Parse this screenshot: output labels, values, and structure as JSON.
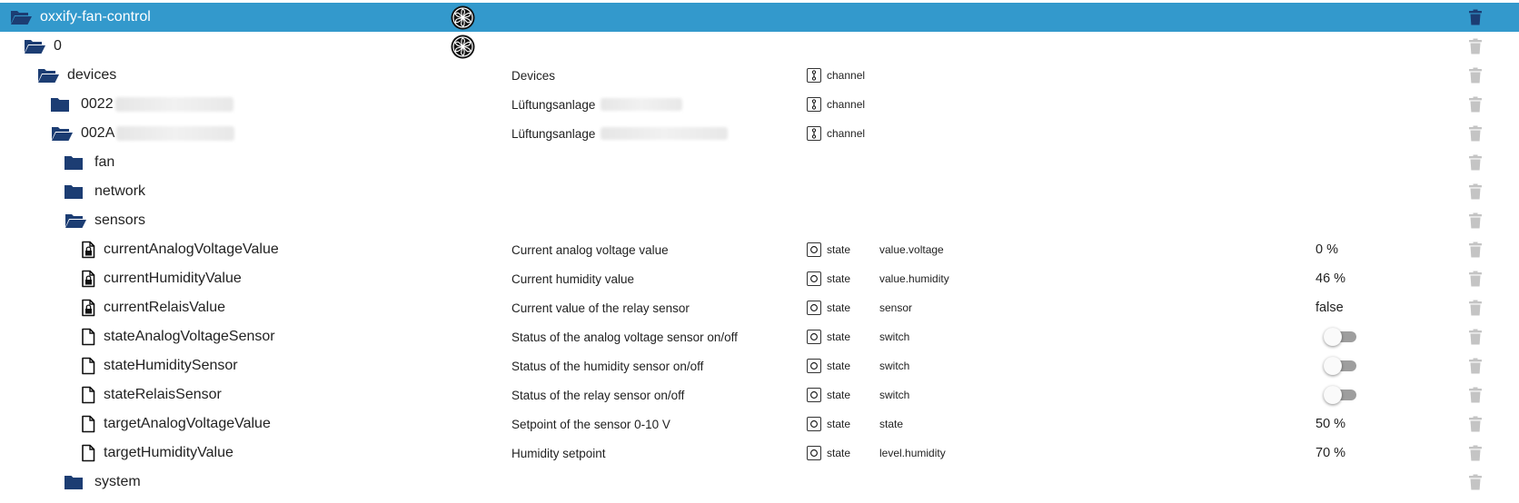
{
  "colors": {
    "selected_bg": "#3399cc",
    "folder": "#1c3d73",
    "trash_disabled": "#c4c4c4",
    "trash_active": "#1c3d73",
    "toggle_off": "#9e9e9e"
  },
  "rows": [
    {
      "id": "adapter",
      "name": "oxxify-fan-control",
      "level": 0,
      "icon": "folder-open-icon",
      "adapterIcon": true,
      "selected": true
    },
    {
      "id": "instance",
      "name": "0",
      "level": 1,
      "icon": "folder-open-icon",
      "adapterIcon": true
    },
    {
      "id": "devices",
      "name": "devices",
      "level": 2,
      "icon": "folder-open-icon",
      "desc": "Devices",
      "type": "channel"
    },
    {
      "id": "device1",
      "name": "0022",
      "level": 3,
      "icon": "folder-closed-icon",
      "blurName": 130,
      "desc": "Lüftungsanlage",
      "blurDesc": 90,
      "type": "channel"
    },
    {
      "id": "device2",
      "name": "002A",
      "level": 3,
      "icon": "folder-open-icon",
      "blurName": 130,
      "desc": "Lüftungsanlage",
      "blurDesc": 140,
      "type": "channel"
    },
    {
      "id": "fan",
      "name": "fan",
      "level": 4,
      "icon": "folder-closed-icon"
    },
    {
      "id": "network",
      "name": "network",
      "level": 4,
      "icon": "folder-closed-icon"
    },
    {
      "id": "sensors",
      "name": "sensors",
      "level": 4,
      "icon": "folder-open-icon"
    },
    {
      "id": "s1",
      "name": "currentAnalogVoltageValue",
      "level": 5,
      "icon": "locked-file-icon",
      "desc": "Current analog voltage value",
      "type": "state",
      "role": "value.voltage",
      "value": "0 %"
    },
    {
      "id": "s2",
      "name": "currentHumidityValue",
      "level": 5,
      "icon": "locked-file-icon",
      "desc": "Current humidity value",
      "type": "state",
      "role": "value.humidity",
      "value": "46 %"
    },
    {
      "id": "s3",
      "name": "currentRelaisValue",
      "level": 5,
      "icon": "locked-file-icon",
      "desc": "Current value of the relay sensor",
      "type": "state",
      "role": "sensor",
      "value": "false"
    },
    {
      "id": "s4",
      "name": "stateAnalogVoltageSensor",
      "level": 5,
      "icon": "file-icon",
      "desc": "Status of the analog voltage sensor on/off",
      "type": "state",
      "role": "switch",
      "toggle": false
    },
    {
      "id": "s5",
      "name": "stateHumiditySensor",
      "level": 5,
      "icon": "file-icon",
      "desc": "Status of the humidity sensor on/off",
      "type": "state",
      "role": "switch",
      "toggle": false
    },
    {
      "id": "s6",
      "name": "stateRelaisSensor",
      "level": 5,
      "icon": "file-icon",
      "desc": "Status of the relay sensor on/off",
      "type": "state",
      "role": "switch",
      "toggle": false
    },
    {
      "id": "s7",
      "name": "targetAnalogVoltageValue",
      "level": 5,
      "icon": "file-icon",
      "desc": "Setpoint of the sensor 0-10 V",
      "type": "state",
      "role": "state",
      "value": "50 %"
    },
    {
      "id": "s8",
      "name": "targetHumidityValue",
      "level": 5,
      "icon": "file-icon",
      "desc": "Humidity setpoint",
      "type": "state",
      "role": "level.humidity",
      "value": "70 %"
    },
    {
      "id": "system",
      "name": "system",
      "level": 4,
      "icon": "folder-closed-icon"
    }
  ]
}
